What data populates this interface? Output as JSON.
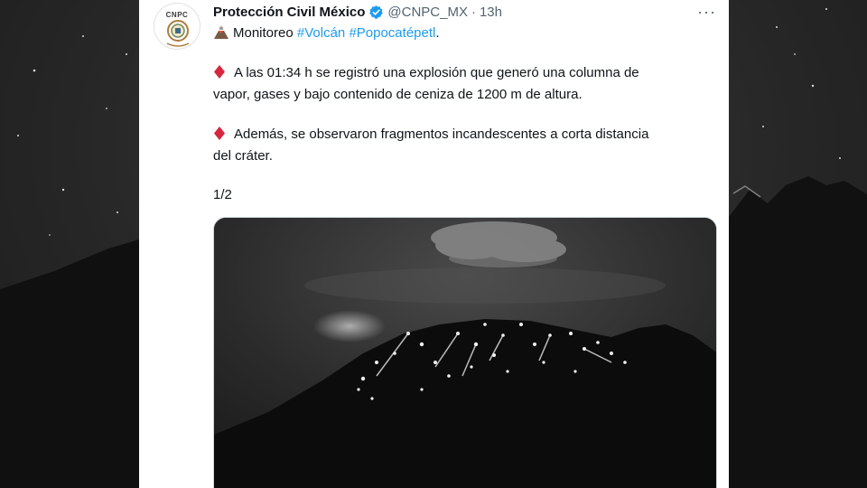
{
  "tweet": {
    "avatar_text": "CNPC",
    "display_name": "Protección Civil México",
    "handle": "@CNPC_MX",
    "separator": "·",
    "time": "13h",
    "more": "···",
    "line1_prefix": "Monitoreo",
    "hashtag1": "#Volcán",
    "hashtag2": "#Popocatépetl",
    "line1_suffix": ".",
    "para1_line1": "A las 01:34 h se registró una explosión que generó una columna de",
    "para1_line2": "vapor, gases y bajo contenido de ceniza de 1200 m de altura.",
    "para2_line1": "Además, se observaron fragmentos incandescentes a corta distancia",
    "para2_line2": "del cráter.",
    "pagination": "1/2"
  },
  "icons": {
    "verified": "verified-badge-icon",
    "volcano": "volcano-emoji-icon",
    "diamond": "red-diamond-emoji-icon",
    "more": "more-options-icon"
  },
  "colors": {
    "hashtag": "#1d9bf0",
    "verified": "#1d9bf0",
    "diamond": "#d7263d",
    "text": "#0f1419",
    "secondary": "#536471"
  }
}
